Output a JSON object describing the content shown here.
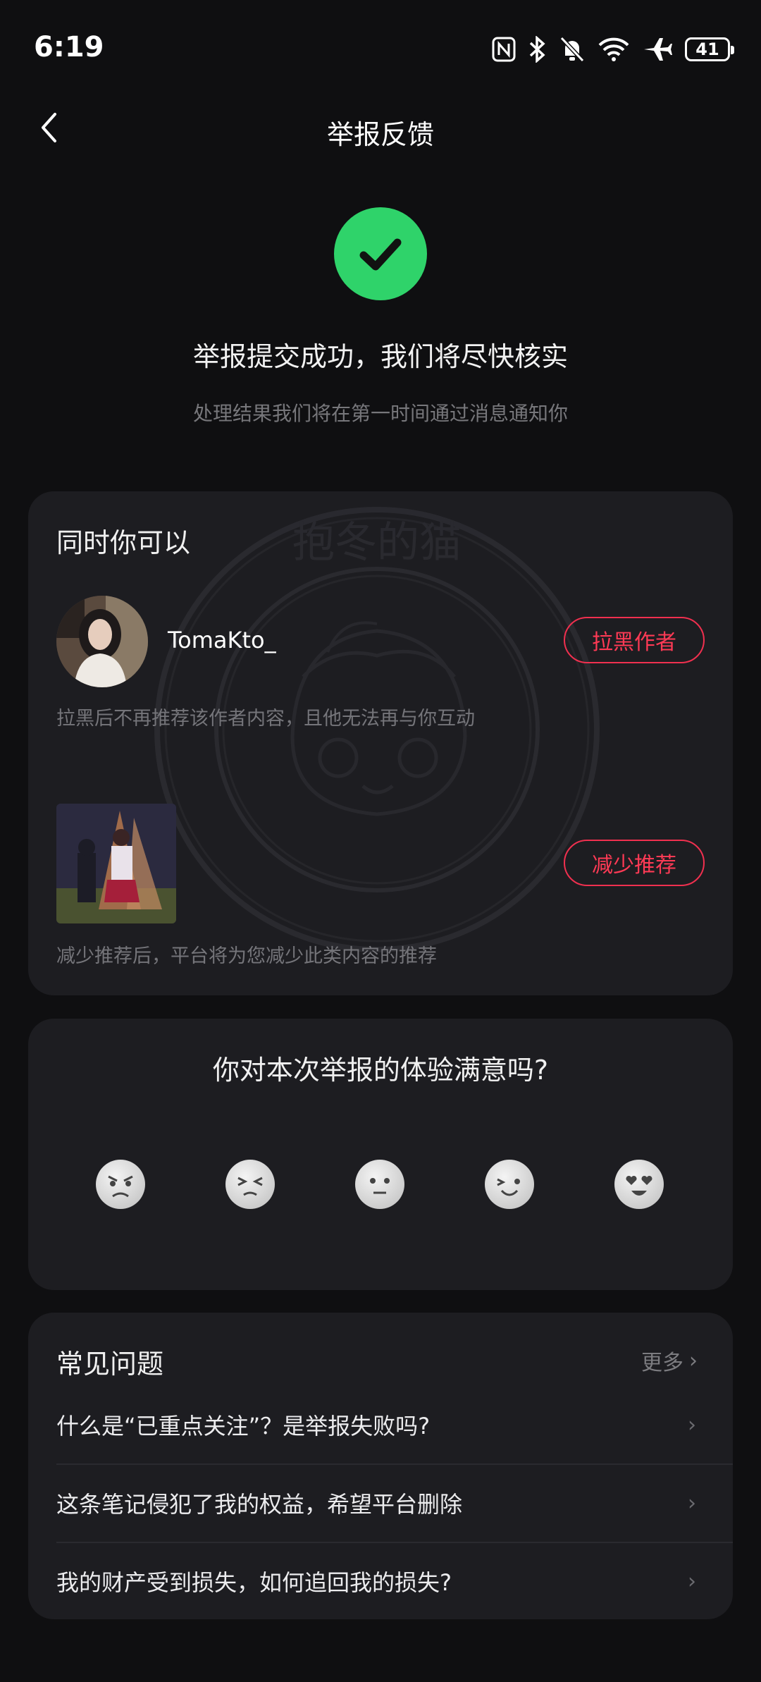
{
  "status_bar": {
    "time": "6:19",
    "battery": "41"
  },
  "nav": {
    "title": "举报反馈"
  },
  "success": {
    "title": "举报提交成功，我们将尽快核实",
    "subtitle": "处理结果我们将在第一时间通过消息通知你"
  },
  "actions": {
    "heading": "同时你可以",
    "author": {
      "name": "TomaKto_",
      "button": "拉黑作者",
      "hint": "拉黑后不再推荐该作者内容，且他无法再与你互动"
    },
    "content": {
      "button": "减少推荐",
      "hint": "减少推荐后，平台将为您减少此类内容的推荐"
    },
    "watermark_text": "抱冬的猫"
  },
  "survey": {
    "title": "你对本次举报的体验满意吗?",
    "faces": [
      "very-unsatisfied-face-icon",
      "unsatisfied-face-icon",
      "neutral-face-icon",
      "satisfied-face-icon",
      "very-satisfied-face-icon"
    ]
  },
  "faq": {
    "heading": "常见问题",
    "more": "更多",
    "items": [
      {
        "text": "什么是“已重点关注”？是举报失败吗?"
      },
      {
        "text": "这条笔记侵犯了我的权益，希望平台删除"
      },
      {
        "text": "我的财产受到损失，如何追回我的损失?"
      }
    ]
  },
  "colors": {
    "accent": "#ff3a55",
    "success": "#2fd36a",
    "card": "#1d1d21",
    "background": "#0f0f11"
  }
}
